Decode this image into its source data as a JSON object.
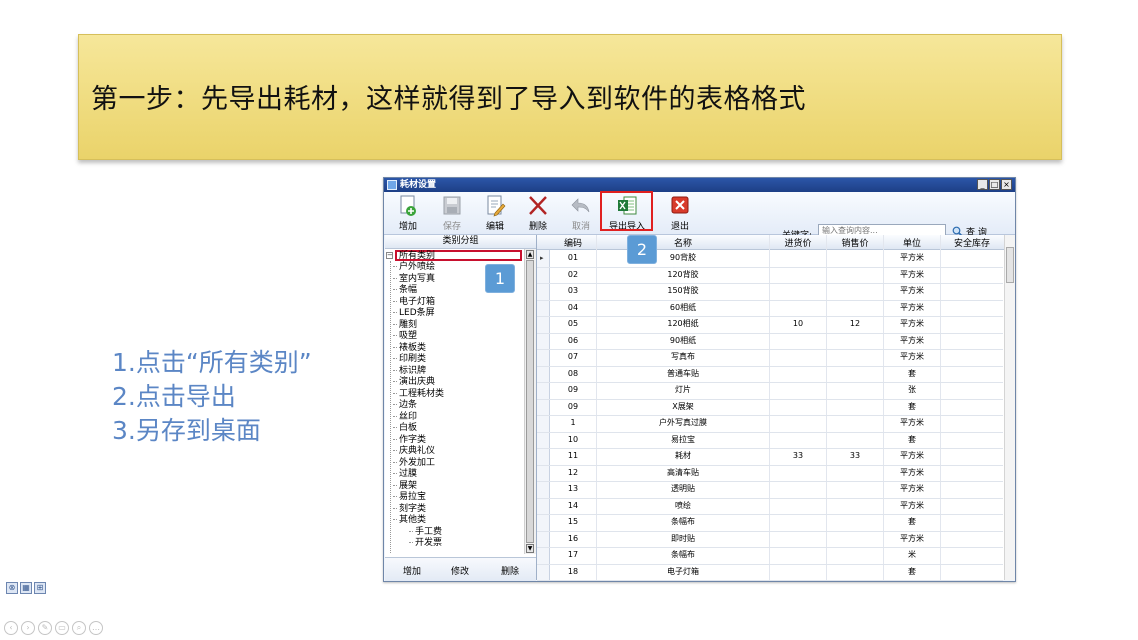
{
  "banner": {
    "text": "第一步：先导出耗材，这样就得到了导入到软件的表格格式"
  },
  "steps": [
    "1.点击“所有类别”",
    "2.点击导出",
    "3.另存到桌面"
  ],
  "window": {
    "title": "耗材设置",
    "controls": [
      "_",
      "□",
      "×"
    ],
    "toolbar": {
      "add": "增加",
      "save": "保存",
      "edit": "编辑",
      "delete": "删除",
      "cancel": "取消",
      "export_import": "导出导入",
      "exit": "退出",
      "keyword_label": "关键字:",
      "keyword_placeholder": "输入查询内容...",
      "search": "查 询"
    },
    "left_panel": {
      "header": "类别分组",
      "root": "所有类别",
      "items": [
        "户外喷绘",
        "室内写真",
        "条幅",
        "电子灯箱",
        "LED条屏",
        "雕刻",
        "吸塑",
        "裱板类",
        "印刷类",
        "标识牌",
        "演出庆典",
        "工程耗材类",
        "边条",
        "丝印",
        "白板",
        "作字类",
        "庆典礼仪",
        "外发加工",
        "过膜",
        "展架",
        "易拉宝",
        "刻字类",
        "其他类"
      ],
      "subitems": [
        "手工费",
        "开发票"
      ],
      "footer": {
        "add": "增加",
        "modify": "修改",
        "delete": "删除"
      }
    },
    "grid": {
      "columns": [
        "编码",
        "名称",
        "进货价",
        "销售价",
        "单位",
        "安全库存"
      ],
      "rows": [
        [
          "01",
          "90背胶",
          "",
          "",
          "平方米",
          ""
        ],
        [
          "02",
          "120背胶",
          "",
          "",
          "平方米",
          ""
        ],
        [
          "03",
          "150背胶",
          "",
          "",
          "平方米",
          ""
        ],
        [
          "04",
          "60相纸",
          "",
          "",
          "平方米",
          ""
        ],
        [
          "05",
          "120相纸",
          "10",
          "12",
          "平方米",
          ""
        ],
        [
          "06",
          "90相纸",
          "",
          "",
          "平方米",
          ""
        ],
        [
          "07",
          "写真布",
          "",
          "",
          "平方米",
          ""
        ],
        [
          "08",
          "普通车贴",
          "",
          "",
          "套",
          ""
        ],
        [
          "09",
          "灯片",
          "",
          "",
          "张",
          ""
        ],
        [
          "09",
          "X展架",
          "",
          "",
          "套",
          ""
        ],
        [
          "1",
          "户外写真过膜",
          "",
          "",
          "平方米",
          ""
        ],
        [
          "10",
          "易拉宝",
          "",
          "",
          "套",
          ""
        ],
        [
          "11",
          "耗材",
          "33",
          "33",
          "平方米",
          ""
        ],
        [
          "12",
          "高清车贴",
          "",
          "",
          "平方米",
          ""
        ],
        [
          "13",
          "透明贴",
          "",
          "",
          "平方米",
          ""
        ],
        [
          "14",
          "喷绘",
          "",
          "",
          "平方米",
          ""
        ],
        [
          "15",
          "条幅布",
          "",
          "",
          "套",
          ""
        ],
        [
          "16",
          "即时贴",
          "",
          "",
          "平方米",
          ""
        ],
        [
          "17",
          "条幅布",
          "",
          "",
          "米",
          ""
        ],
        [
          "18",
          "电子灯箱",
          "",
          "",
          "套",
          ""
        ]
      ]
    },
    "badges": [
      "1",
      "2"
    ]
  },
  "colors": {
    "accent_red": "#e02020",
    "badge_blue": "#5b9bd5",
    "steps_blue": "#5b86c5",
    "title_bar": "#2c56a8"
  }
}
